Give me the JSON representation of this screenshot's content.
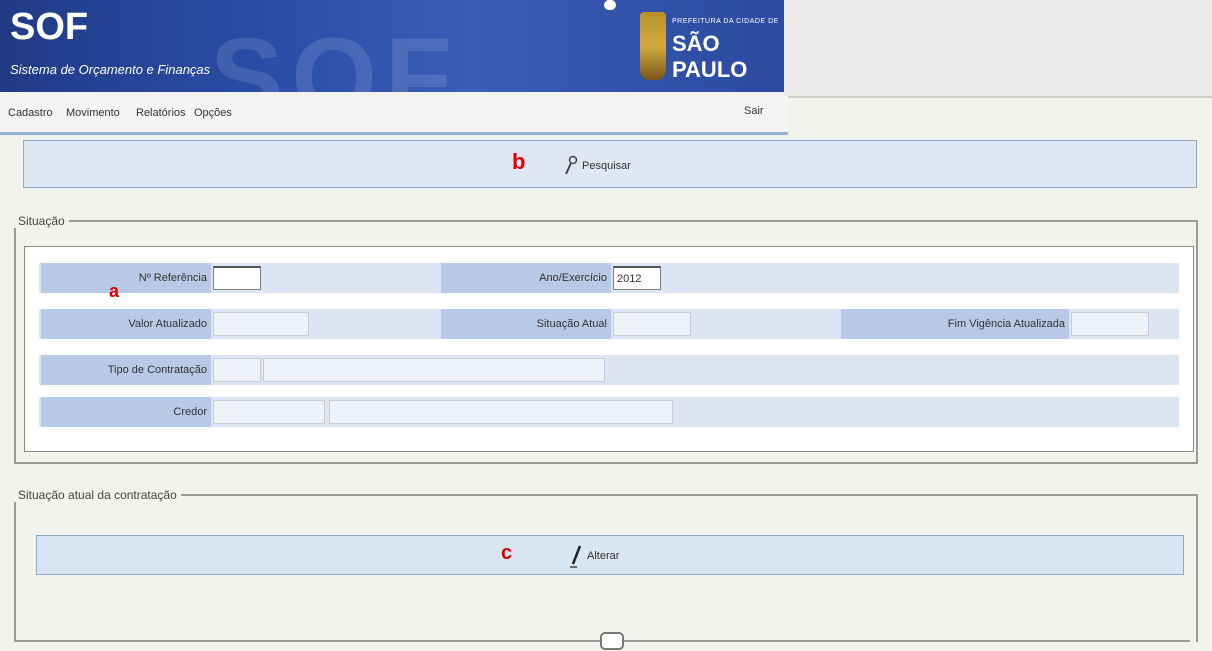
{
  "banner": {
    "logo": "SOF",
    "subtitle": "Sistema de Orçamento e Finanças",
    "watermark": "SOF",
    "city_small": "PREFEITURA DA CIDADE DE",
    "city_name": "SÃO PAULO"
  },
  "menu": {
    "items": [
      "Cadastro",
      "Movimento",
      "Relatórios",
      "Opções"
    ],
    "exit": "Sair"
  },
  "toolbar": {
    "search_label": "Pesquisar",
    "annotation": "b"
  },
  "situacao": {
    "legend": "Situação",
    "annotation": "a",
    "fields": {
      "numero_referencia": {
        "label": "Nº Referência",
        "value": ""
      },
      "ano_exercicio": {
        "label": "Ano/Exercício",
        "value": "2012"
      },
      "valor_atualizado": {
        "label": "Valor Atualizado",
        "value": ""
      },
      "situacao_atual": {
        "label": "Situação Atual",
        "value": ""
      },
      "fim_vigencia": {
        "label": "Fim Vigência Atualizada",
        "value": ""
      },
      "tipo_contratacao": {
        "label": "Tipo de Contratação",
        "code": "",
        "desc": ""
      },
      "credor": {
        "label": "Credor",
        "code": "",
        "desc": ""
      }
    }
  },
  "situacao_atual_contratacao": {
    "legend": "Situação atual da contratação",
    "annotation": "c",
    "alter_label": "Alterar"
  },
  "colors": {
    "banner": "#2c4ea8",
    "label_bg": "#b7c9e6",
    "row_bg": "#dbe5f3",
    "annotation": "#e00000"
  }
}
